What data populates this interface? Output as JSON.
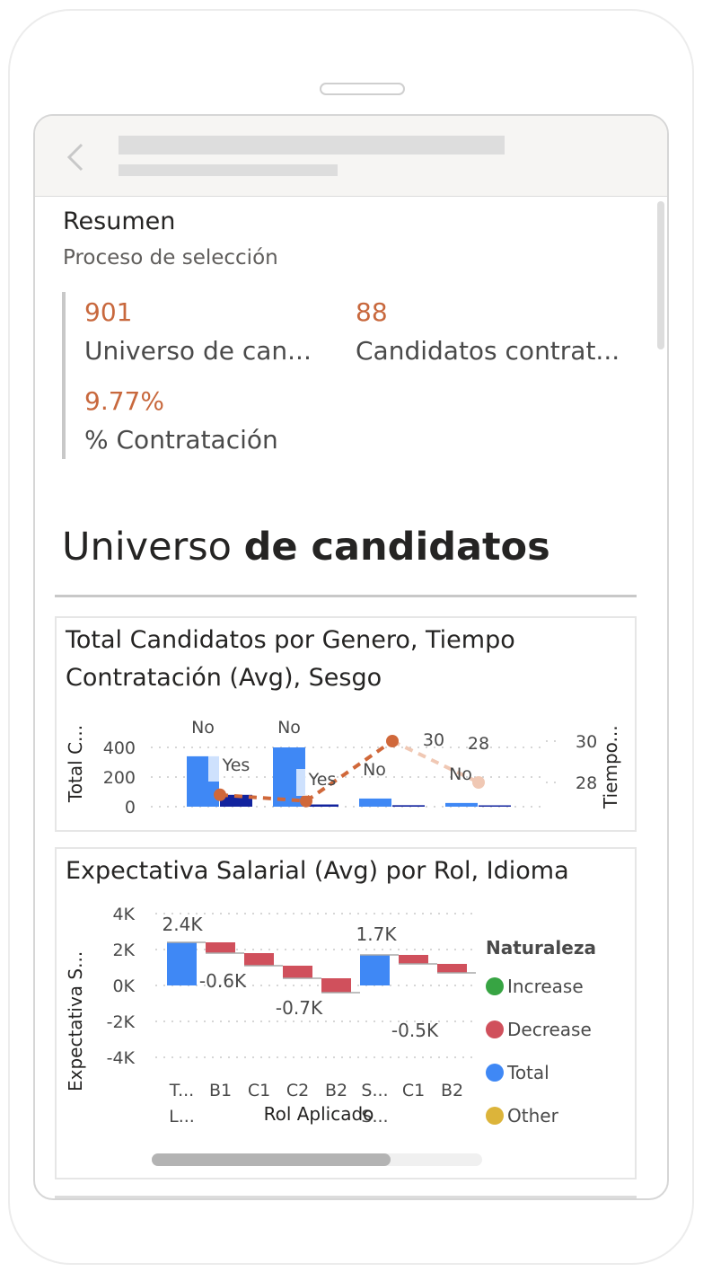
{
  "summary": {
    "title": "Resumen",
    "subtitle": "Proceso de selección",
    "kpis": [
      {
        "value": "901",
        "label": "Universo de can..."
      },
      {
        "value": "88",
        "label": "Candidatos contrat..."
      },
      {
        "value": "9.77%",
        "label": "% Contratación"
      }
    ]
  },
  "section": {
    "title_regular": "Universo ",
    "title_bold": "de candidatos"
  },
  "chart1": {
    "title": "Total Candidatos por Genero, Tiempo Contratación (Avg), Sesgo",
    "ylabel_left": "Total C...",
    "ylabel_right": "Tiempo...",
    "left_ticks": [
      "400",
      "200",
      "0"
    ],
    "right_ticks": [
      "30",
      "28"
    ],
    "bar_labels": [
      "No",
      "Yes",
      "No",
      "Yes",
      "No",
      "No"
    ],
    "point_labels": [
      "30",
      "28"
    ],
    "colors": {
      "bar_light": "#3f88f5",
      "bar_dark": "#12239e",
      "line": "#d0683a",
      "line_faded": "#f0c8b4"
    }
  },
  "chart_data": [
    {
      "type": "bar",
      "title": "Total Candidatos por Genero, Tiempo Contratación (Avg), Sesgo",
      "ylabel": "Total C...",
      "y2label": "Tiempo...",
      "ylim": [
        0,
        400
      ],
      "series": [
        {
          "name": "No",
          "values": [
            340,
            400,
            55,
            25
          ]
        },
        {
          "name": "Yes",
          "values": [
            80,
            15,
            10,
            0
          ]
        },
        {
          "name": "Tiempo Contratación (Avg)",
          "values": [
            27.4,
            27.1,
            30,
            28
          ]
        }
      ]
    },
    {
      "type": "bar",
      "title": "Expectativa Salarial (Avg) por Rol, Idioma",
      "xlabel": "Rol Aplicado",
      "ylabel": "Expectativa S...",
      "ylim": [
        -4000,
        4000
      ],
      "categories": [
        "T... L...",
        "B1",
        "C1",
        "C2",
        "B2",
        "S... S...",
        "C1",
        "B2"
      ],
      "values": [
        2400,
        -600,
        -700,
        -700,
        -800,
        1700,
        -500,
        -500
      ],
      "data_labels": [
        "2.4K",
        "-0.6K",
        "-0.7K",
        "1.7K",
        "-0.5K"
      ],
      "legend": {
        "title": "Naturaleza",
        "items": [
          "Increase",
          "Decrease",
          "Total",
          "Other"
        ],
        "position": "right"
      }
    }
  ],
  "chart2": {
    "title": "Expectativa Salarial (Avg) por Rol, Idioma",
    "ylabel": "Expectativa S...",
    "xlabel": "Rol Aplicado",
    "y_ticks": [
      "4K",
      "2K",
      "0K",
      "-2K",
      "-4K"
    ],
    "categories_line1": [
      "T...",
      "B1",
      "C1",
      "C2",
      "B2",
      "S...",
      "C1",
      "B2"
    ],
    "categories_line2": [
      "L...",
      "",
      "",
      "",
      "",
      "S...",
      "",
      ""
    ],
    "data_labels": [
      "2.4K",
      "-0.6K",
      "-0.7K",
      "1.7K",
      "-0.5K"
    ],
    "legend_title": "Naturaleza",
    "legend": [
      {
        "label": "Increase",
        "color": "#37a443"
      },
      {
        "label": "Decrease",
        "color": "#d0505c"
      },
      {
        "label": "Total",
        "color": "#3f88f5"
      },
      {
        "label": "Other",
        "color": "#dcb43a"
      }
    ]
  }
}
